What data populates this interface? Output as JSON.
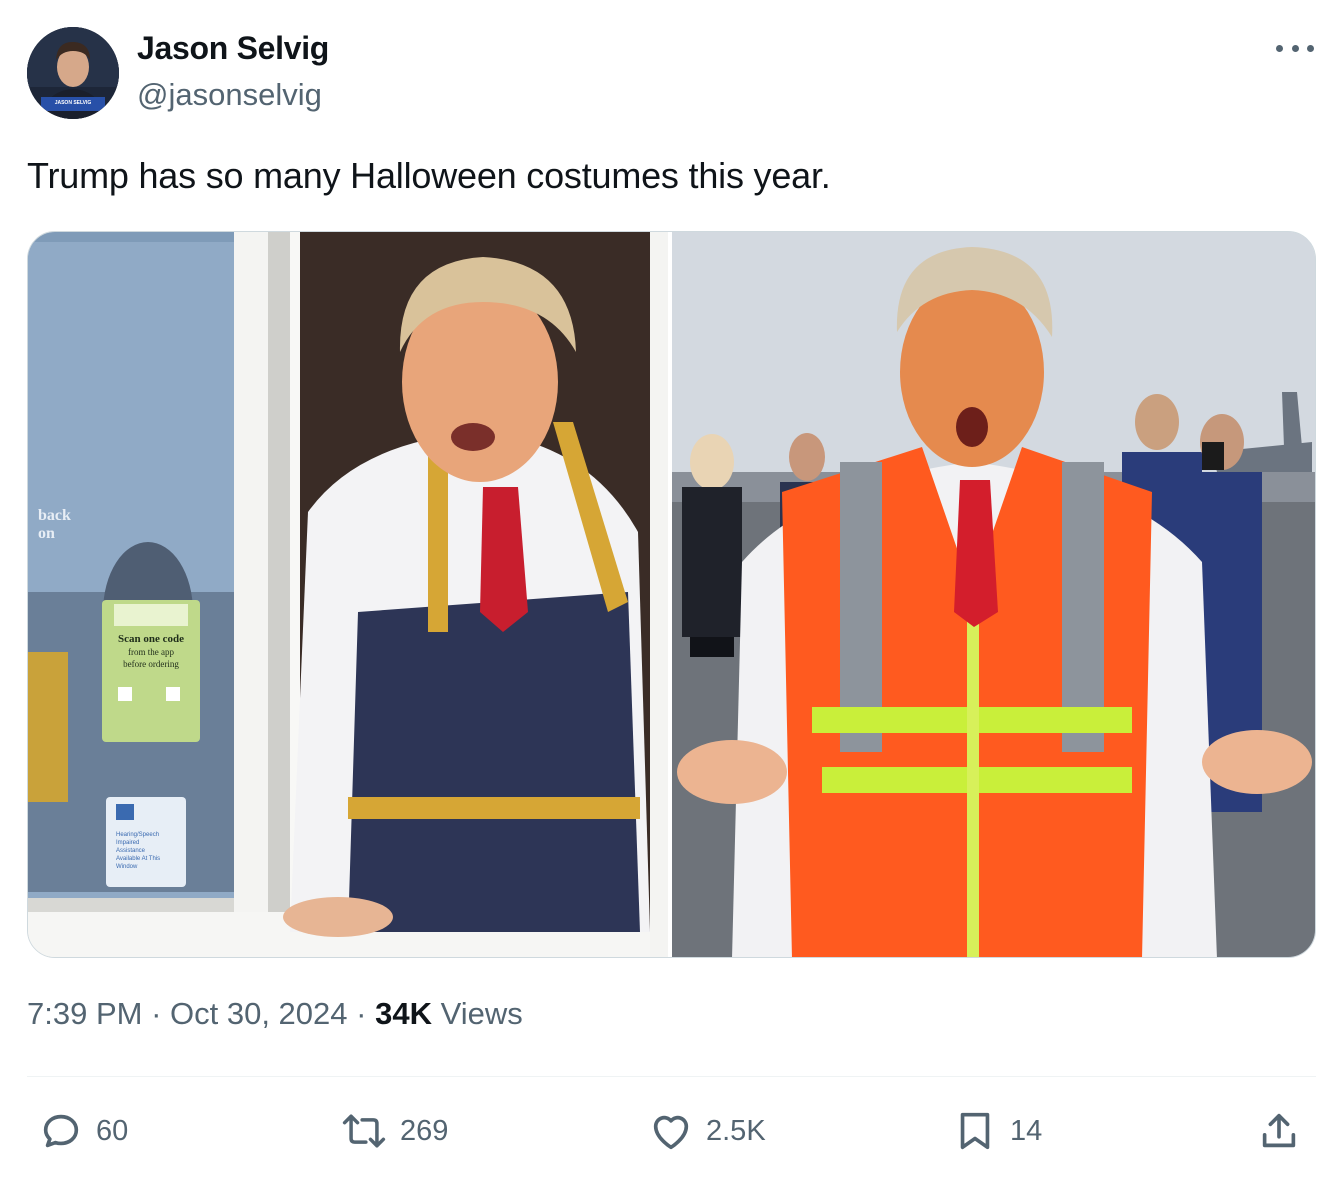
{
  "author": {
    "display_name": "Jason Selvig",
    "handle": "@jasonselvig",
    "avatar_caption": "JASON SELVIG"
  },
  "tweet": {
    "text": "Trump has so many Halloween costumes this year.",
    "time": "7:39 PM",
    "date": "Oct 30, 2024",
    "views_count": "34K",
    "views_label": "Views"
  },
  "media": [
    {
      "description_icon": "photo",
      "sign_lines": [
        "Scan one code",
        "from the app",
        "before ordering"
      ],
      "window_lines": [
        "back",
        "on"
      ],
      "notice_lines": [
        "Hearing/Speech",
        "Impaired",
        "Assistance",
        "Available At This",
        "Window"
      ]
    },
    {
      "description_icon": "photo"
    }
  ],
  "actions": {
    "reply": {
      "count": "60",
      "icon": "reply-icon"
    },
    "retweet": {
      "count": "269",
      "icon": "retweet-icon"
    },
    "like": {
      "count": "2.5K",
      "icon": "heart-icon"
    },
    "bookmark": {
      "count": "14",
      "icon": "bookmark-icon"
    },
    "share": {
      "icon": "share-icon"
    }
  },
  "colors": {
    "text_primary": "#0f1419",
    "text_secondary": "#536471",
    "border": "#cfd9de"
  }
}
